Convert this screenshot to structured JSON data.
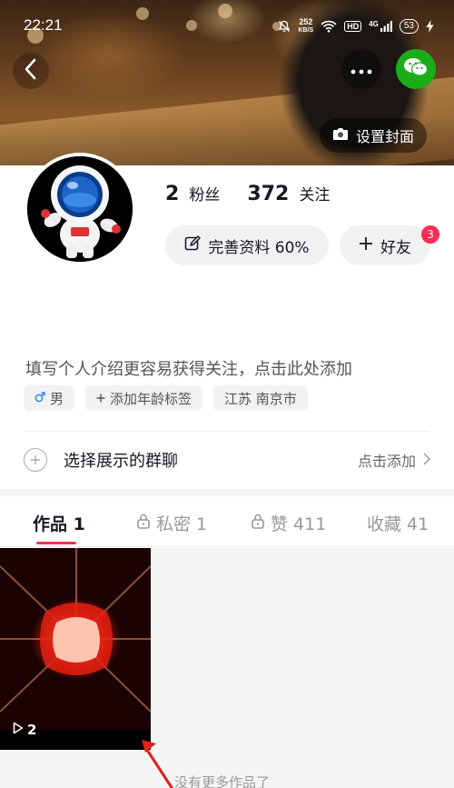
{
  "status_bar": {
    "time": "22:21",
    "net_speed_value": "252",
    "net_speed_unit": "KB/S",
    "hd": "HD",
    "network": "4G",
    "battery": "53"
  },
  "header": {
    "set_cover_label": "设置封面"
  },
  "profile": {
    "fans_count": "2",
    "fans_label": "粉丝",
    "following_count": "372",
    "following_label": "关注",
    "edit_profile_label": "完善资料 60%",
    "add_friend_label": "好友",
    "friend_badge": "3",
    "bio_placeholder": "填写个人介绍更容易获得关注，点击此处添加",
    "tags": {
      "gender": "男",
      "age": "添加年龄标签",
      "location": "江苏 南京市"
    }
  },
  "group": {
    "label": "选择展示的群聊",
    "action": "点击添加"
  },
  "tabs": {
    "works": "作品 1",
    "private": "私密 1",
    "likes": "赞 411",
    "favorites": "收藏 41"
  },
  "video": {
    "play_count": "2"
  },
  "footer": {
    "no_more": "没有更多作品了"
  }
}
